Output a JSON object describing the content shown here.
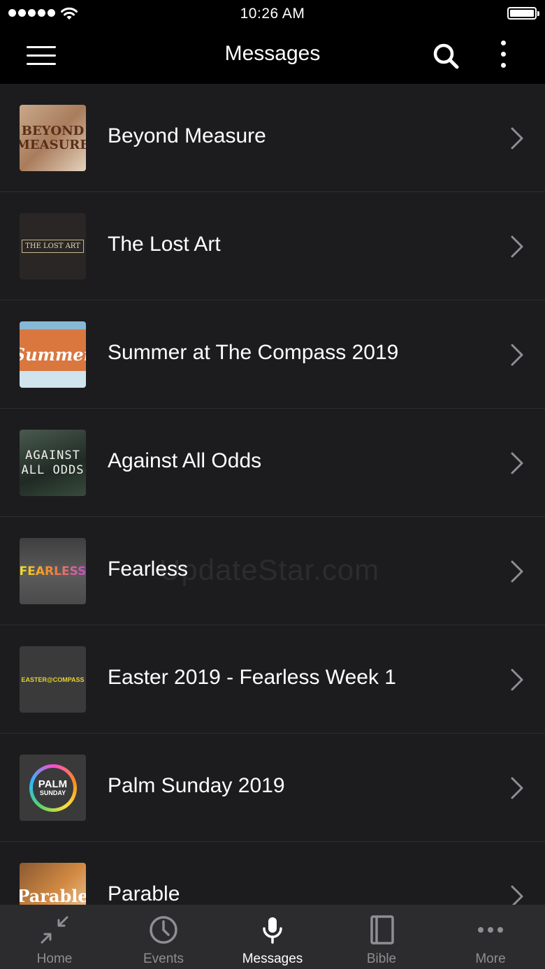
{
  "status_bar": {
    "time": "10:26 AM"
  },
  "nav": {
    "title": "Messages"
  },
  "list": {
    "items": [
      {
        "title": "Beyond Measure",
        "thumb_text": [
          "BEYOND",
          "MEASURE"
        ]
      },
      {
        "title": "The Lost Art",
        "thumb_text": [
          "THE LOST ART"
        ]
      },
      {
        "title": "Summer at The Compass 2019",
        "thumb_text": [
          "Summer"
        ]
      },
      {
        "title": "Against All Odds",
        "thumb_text": [
          "AGAINST",
          "ALL ODDS"
        ]
      },
      {
        "title": "Fearless",
        "thumb_text": [
          "FEARLESS"
        ]
      },
      {
        "title": "Easter 2019 - Fearless Week 1",
        "thumb_text": [
          "EASTER@COMPASS"
        ]
      },
      {
        "title": "Palm Sunday 2019",
        "thumb_text": [
          "PALM",
          "SUNDAY"
        ]
      },
      {
        "title": "Parable",
        "thumb_text": [
          "Parable"
        ]
      }
    ]
  },
  "tabs": [
    {
      "label": "Home",
      "icon": "home-icon"
    },
    {
      "label": "Events",
      "icon": "clock-icon"
    },
    {
      "label": "Messages",
      "icon": "microphone-icon",
      "active": true
    },
    {
      "label": "Bible",
      "icon": "book-icon"
    },
    {
      "label": "More",
      "icon": "more-dots-icon"
    }
  ],
  "watermark": "UpdateStar.com",
  "colors": {
    "background": "#1c1c1e",
    "bar": "#000000",
    "tab_bar": "#2c2c2e",
    "tab_inactive": "#8e8e93",
    "tab_active": "#ffffff"
  }
}
